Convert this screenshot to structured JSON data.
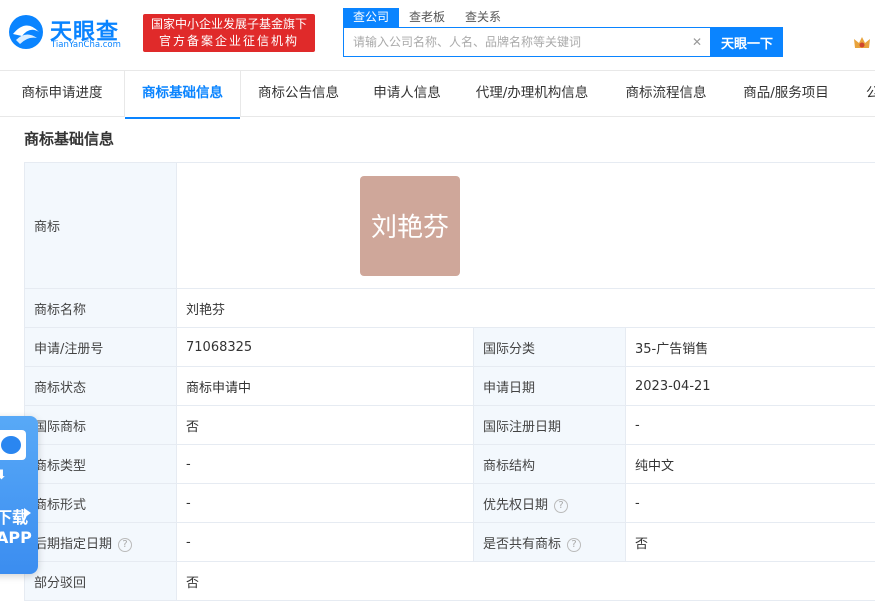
{
  "brand": {
    "name_cn": "天眼查",
    "name_en": "TianYanCha.com",
    "logo_color": "#0a84ff"
  },
  "gov_badge": {
    "line1": "国家中小企业发展子基金旗下",
    "line2": "官方备案企业征信机构",
    "color": "#e02a2a"
  },
  "search": {
    "tabs": [
      "查公司",
      "查老板",
      "查关系"
    ],
    "active_tab": 0,
    "placeholder": "请输入公司名称、人名、品牌名称等关键词",
    "value": "",
    "button_label": "天眼一下"
  },
  "nav": {
    "tabs": [
      "商标申请进度",
      "商标基础信息",
      "商标公告信息",
      "申请人信息",
      "代理/办理机构信息",
      "商标流程信息",
      "商品/服务项目",
      "公"
    ],
    "active_index": 1
  },
  "section": {
    "title": "商标基础信息"
  },
  "trademark": {
    "logo_label": "商标",
    "logo_text": "刘艳芬",
    "logo_bg": "#cfa79a",
    "name_label": "商标名称",
    "name_value": "刘艳芬",
    "rows": [
      {
        "l1": "申请/注册号",
        "v1": "71068325",
        "l2": "国际分类",
        "v2": "35-广告销售"
      },
      {
        "l1": "商标状态",
        "v1": "商标申请中",
        "l2": "申请日期",
        "v2": "2023-04-21"
      },
      {
        "l1": "国际商标",
        "v1": "否",
        "l2": "国际注册日期",
        "v2": "-"
      },
      {
        "l1": "商标类型",
        "v1": "-",
        "l2": "商标结构",
        "v2": "纯中文"
      },
      {
        "l1": "商标形式",
        "v1": "-",
        "l2": "优先权日期",
        "v2": "-"
      },
      {
        "l1": "后期指定日期",
        "v1": "-",
        "l2": "是否共有商标",
        "v2": "否"
      }
    ],
    "last_label": "部分驳回",
    "last_value": "否"
  },
  "float_app": {
    "line1": "下载",
    "line2": "APP"
  }
}
